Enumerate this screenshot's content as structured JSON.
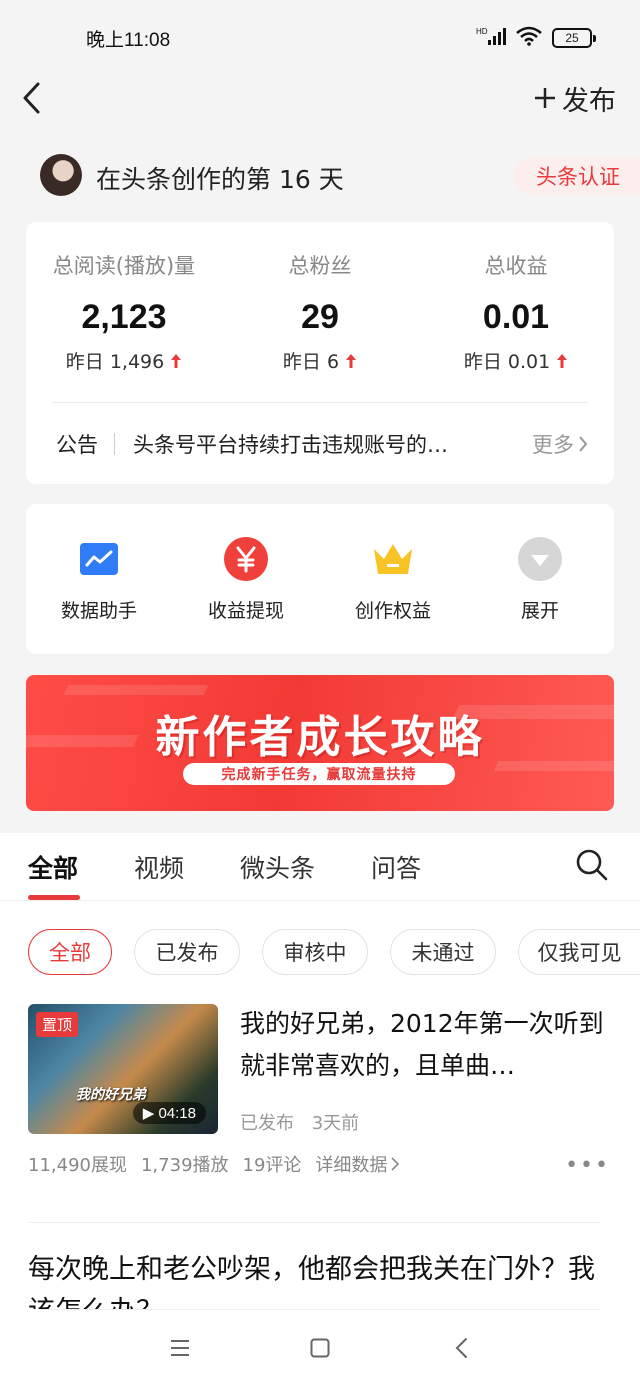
{
  "status_bar": {
    "time": "晚上11:08",
    "battery": "25",
    "network": "HD"
  },
  "nav": {
    "publish_label": "发布"
  },
  "creator": {
    "days_text": "在头条创作的第 16 天",
    "cert_label": "头条认证"
  },
  "stats": [
    {
      "label": "总阅读(播放)量",
      "value": "2,123",
      "yesterday": "昨日 1,496"
    },
    {
      "label": "总粉丝",
      "value": "29",
      "yesterday": "昨日 6"
    },
    {
      "label": "总收益",
      "value": "0.01",
      "yesterday": "昨日 0.01"
    }
  ],
  "notice": {
    "label": "公告",
    "text": "头条号平台持续打击违规账号的…",
    "more": "更多"
  },
  "tools": [
    {
      "label": "数据助手",
      "icon": "chart-icon"
    },
    {
      "label": "收益提现",
      "icon": "yuan-icon"
    },
    {
      "label": "创作权益",
      "icon": "crown-icon"
    },
    {
      "label": "展开",
      "icon": "expand-icon"
    }
  ],
  "banner": {
    "title": "新作者成长攻略",
    "subtitle": "完成新手任务，赢取流量扶持"
  },
  "tabs": [
    {
      "label": "全部"
    },
    {
      "label": "视频"
    },
    {
      "label": "微头条"
    },
    {
      "label": "问答"
    }
  ],
  "filters": [
    {
      "label": "全部"
    },
    {
      "label": "已发布"
    },
    {
      "label": "审核中"
    },
    {
      "label": "未通过"
    },
    {
      "label": "仅我可见"
    }
  ],
  "posts": [
    {
      "pin": "置顶",
      "thumb_caption": "我的好兄弟",
      "duration": "04:18",
      "title": "我的好兄弟，2012年第一次听到就非常喜欢的，且单曲…",
      "status": "已发布",
      "time": "3天前",
      "impressions": "11,490展现",
      "plays": "1,739播放",
      "comments": "19评论",
      "detail_link": "详细数据"
    },
    {
      "title": "每次晚上和老公吵架，他都会把我关在门外？我该怎么办？"
    }
  ],
  "colors": {
    "accent": "#e83a3a",
    "background": "#f4f4f4"
  }
}
